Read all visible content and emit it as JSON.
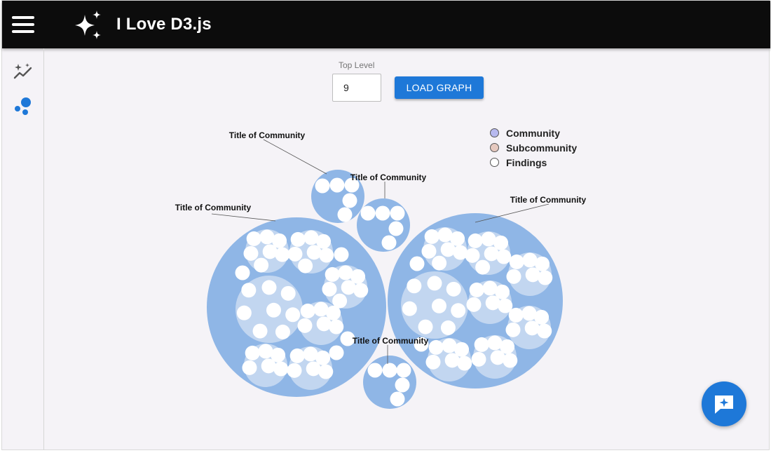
{
  "app": {
    "title": "I Love D3.js"
  },
  "icons": {
    "menu": "hamburger-menu-icon",
    "logo": "sparkles-icon",
    "sidebar": [
      "insights-sparkle-icon",
      "bubble-chart-icon"
    ],
    "fab": "chat-sparkle-icon"
  },
  "controls": {
    "level_label": "Top Level",
    "level_value": "9",
    "load_button": "LOAD GRAPH"
  },
  "legend": [
    {
      "label": "Community",
      "color": "#b7b9ef"
    },
    {
      "label": "Subcommunity",
      "color": "#e6c9bf"
    },
    {
      "label": "Findings",
      "color": "#ffffff"
    }
  ],
  "graph": {
    "labels": [
      "Title of Community",
      "Title of Community",
      "Title of Community",
      "Title of Community",
      "Title of Community"
    ]
  },
  "colors": {
    "accent": "#1e78d8",
    "community_fill": "#8fb6e6",
    "subcommunity_fill": "#c2d6f0",
    "finding_fill": "#ffffff"
  }
}
